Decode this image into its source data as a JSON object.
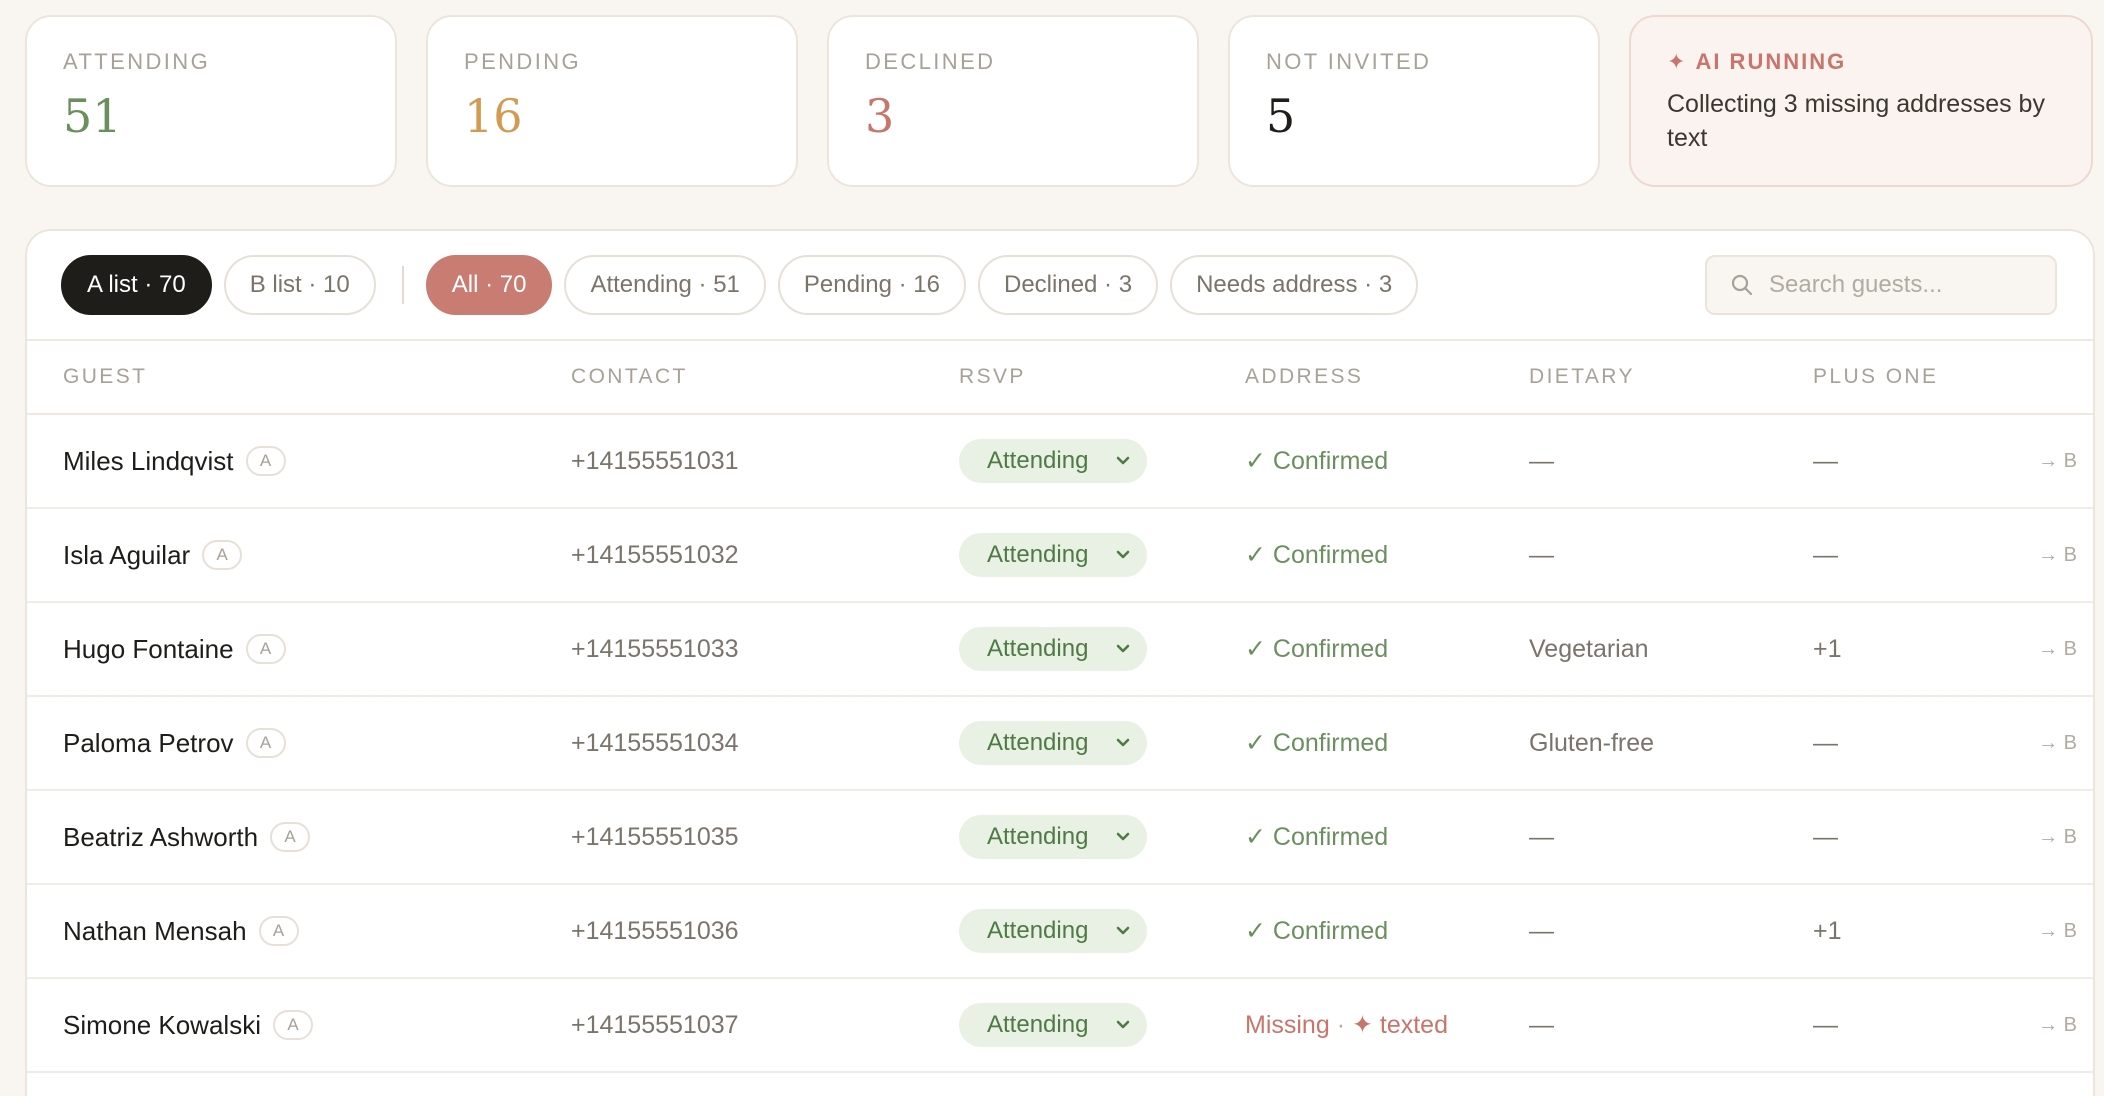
{
  "stats": {
    "attending": {
      "label": "ATTENDING",
      "value": "51"
    },
    "pending": {
      "label": "PENDING",
      "value": "16"
    },
    "declined": {
      "label": "DECLINED",
      "value": "3"
    },
    "not_invited": {
      "label": "NOT INVITED",
      "value": "5"
    },
    "ai": {
      "label": "AI RUNNING",
      "icon": "sparkle-icon",
      "description": "Collecting 3 missing addresses by text"
    }
  },
  "toolbar": {
    "lists": [
      {
        "label": "A list · 70"
      },
      {
        "label": "B list · 10"
      }
    ],
    "filters": [
      {
        "label": "All · 70"
      },
      {
        "label": "Attending · 51"
      },
      {
        "label": "Pending · 16"
      },
      {
        "label": "Declined · 3"
      },
      {
        "label": "Needs address · 3"
      }
    ],
    "search": {
      "placeholder": "Search guests...",
      "value": ""
    }
  },
  "table": {
    "headers": {
      "guest": "GUEST",
      "contact": "CONTACT",
      "rsvp": "RSVP",
      "address": "ADDRESS",
      "dietary": "DIETARY",
      "plus_one": "PLUS ONE"
    },
    "rows": [
      {
        "name": "Miles Lindqvist",
        "tag": "A",
        "contact": "+14155551031",
        "rsvp": "Attending",
        "address": "✓ Confirmed",
        "dietary": "—",
        "plus_one": "—",
        "move": "→ B"
      },
      {
        "name": "Isla Aguilar",
        "tag": "A",
        "contact": "+14155551032",
        "rsvp": "Attending",
        "address": "✓ Confirmed",
        "dietary": "—",
        "plus_one": "—",
        "move": "→ B"
      },
      {
        "name": "Hugo Fontaine",
        "tag": "A",
        "contact": "+14155551033",
        "rsvp": "Attending",
        "address": "✓ Confirmed",
        "dietary": "Vegetarian",
        "plus_one": "+1",
        "move": "→ B"
      },
      {
        "name": "Paloma Petrov",
        "tag": "A",
        "contact": "+14155551034",
        "rsvp": "Attending",
        "address": "✓ Confirmed",
        "dietary": "Gluten-free",
        "plus_one": "—",
        "move": "→ B"
      },
      {
        "name": "Beatriz Ashworth",
        "tag": "A",
        "contact": "+14155551035",
        "rsvp": "Attending",
        "address": "✓ Confirmed",
        "dietary": "—",
        "plus_one": "—",
        "move": "→ B"
      },
      {
        "name": "Nathan Mensah",
        "tag": "A",
        "contact": "+14155551036",
        "rsvp": "Attending",
        "address": "✓ Confirmed",
        "dietary": "—",
        "plus_one": "+1",
        "move": "→ B"
      },
      {
        "name": "Simone Kowalski",
        "tag": "A",
        "contact": "+14155551037",
        "rsvp": "Attending",
        "address_missing": "Missing",
        "address_sep": "·",
        "address_texted": "✦ texted",
        "dietary": "—",
        "plus_one": "—",
        "move": "→ B"
      }
    ]
  },
  "colors": {
    "background": "#f9f6f1",
    "attending": "#6b8f5f",
    "pending": "#d39a52",
    "declined": "#c8766b",
    "active_filter": "#c97c72",
    "dark_pill": "#1f1d1a"
  }
}
